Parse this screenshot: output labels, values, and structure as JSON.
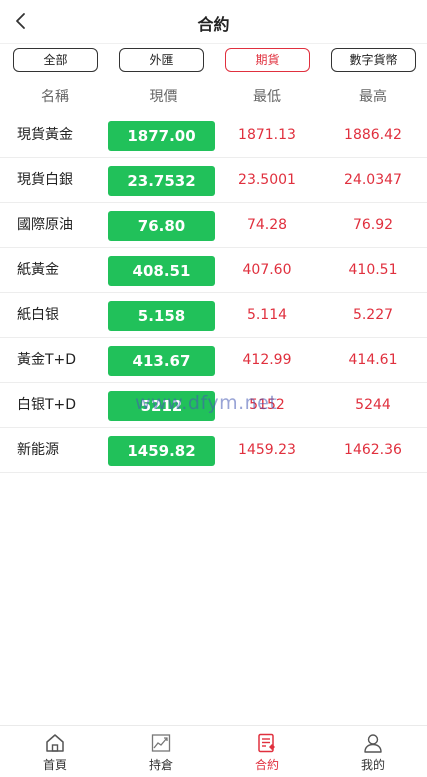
{
  "header": {
    "title": "合約"
  },
  "filters": [
    {
      "label": "全部"
    },
    {
      "label": "外匯"
    },
    {
      "label": "期貨"
    },
    {
      "label": "數字貨幣"
    }
  ],
  "active_filter": "期貨",
  "columns": {
    "name": "名稱",
    "price": "現價",
    "low": "最低",
    "high": "最高"
  },
  "rows": [
    {
      "name": "現貨黃金",
      "price": "1877.00",
      "low": "1871.13",
      "high": "1886.42"
    },
    {
      "name": "現貨白銀",
      "price": "23.7532",
      "low": "23.5001",
      "high": "24.0347"
    },
    {
      "name": "國際原油",
      "price": "76.80",
      "low": "74.28",
      "high": "76.92"
    },
    {
      "name": "紙黃金",
      "price": "408.51",
      "low": "407.60",
      "high": "410.51"
    },
    {
      "name": "紙白银",
      "price": "5.158",
      "low": "5.114",
      "high": "5.227"
    },
    {
      "name": "黃金T+D",
      "price": "413.67",
      "low": "412.99",
      "high": "414.61"
    },
    {
      "name": "白银T+D",
      "price": "5212",
      "low": "5152",
      "high": "5244"
    },
    {
      "name": "新能源",
      "price": "1459.82",
      "low": "1459.23",
      "high": "1462.36"
    }
  ],
  "watermark": "www.dfym.net",
  "tabs": [
    {
      "label": "首頁",
      "icon": "home-icon"
    },
    {
      "label": "持倉",
      "icon": "chart-icon"
    },
    {
      "label": "合約",
      "icon": "contract-icon"
    },
    {
      "label": "我的",
      "icon": "user-icon"
    }
  ],
  "active_tab": "合約",
  "colors": {
    "accent": "#e0303e",
    "price_bg": "#21c15a"
  }
}
